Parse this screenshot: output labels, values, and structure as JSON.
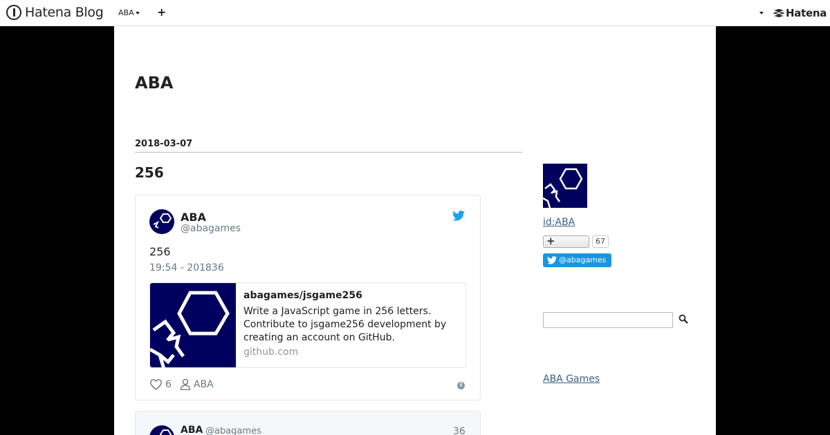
{
  "header": {
    "logo_text": "Hatena Blog",
    "blog_menu_label": "ABA",
    "add_label": "+",
    "hatena_logo_text": "Hatena"
  },
  "blog": {
    "title": "ABA"
  },
  "entry": {
    "date": "2018-03-07",
    "title": "256"
  },
  "tweet": {
    "name": "ABA",
    "handle": "@abagames",
    "text": "256",
    "time": "19:54 - 201836",
    "card": {
      "title": "abagames/jsgame256",
      "description": "Write a JavaScript game in 256 letters. Contribute to jsgame256 development by creating an account on GitHub.",
      "domain": "github.com"
    },
    "likes": "6",
    "author_label": "ABA",
    "info_glyph": "i"
  },
  "tweet2": {
    "name": "ABA",
    "handle": "@abagames",
    "count": "36"
  },
  "sidebar": {
    "profile_id": "id:ABA",
    "subscribe_label": "+",
    "subscribe_count": "67",
    "twitter_follow_label": "@abagames",
    "search_placeholder": "",
    "link_label": "ABA Games"
  },
  "colors": {
    "page_bg": "#000000",
    "content_bg": "#ffffff",
    "avatar_bg": "#00005e",
    "twitter_blue": "#1b95e0",
    "link": "#3b5e85"
  },
  "icons": [
    "hatena-blog-logo-icon",
    "caret-down-icon",
    "plus-icon",
    "hatena-logo-icon",
    "twitter-bird-icon",
    "heart-icon",
    "person-icon",
    "info-icon",
    "search-icon"
  ]
}
